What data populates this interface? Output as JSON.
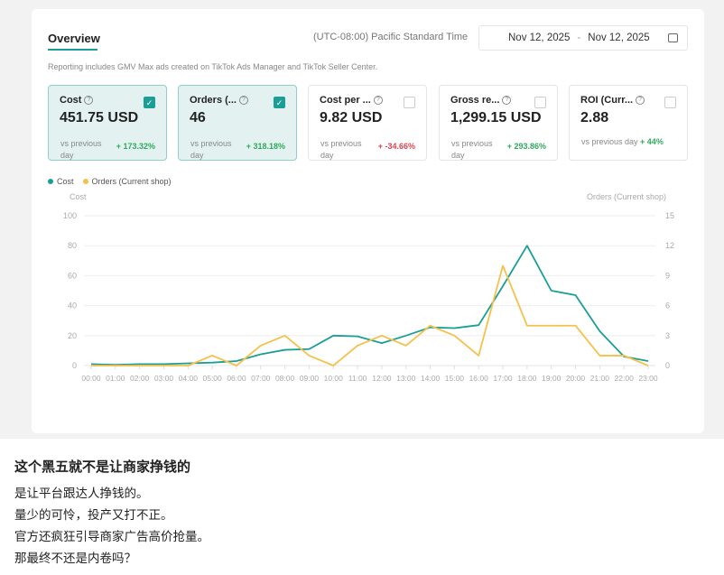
{
  "header": {
    "title": "Overview",
    "timezone": "(UTC-08:00) Pacific Standard Time",
    "date_start": "Nov 12, 2025",
    "date_sep": "-",
    "date_end": "Nov 12, 2025",
    "note": "Reporting includes GMV Max ads created on TikTok Ads Manager and TikTok Seller Center."
  },
  "kpis": [
    {
      "label": "Cost",
      "value": "451.75 USD",
      "vs": "vs previous day",
      "change": "+ 173.32%",
      "trend": "up",
      "checked": true
    },
    {
      "label": "Orders (...",
      "value": "46",
      "vs": "vs previous day",
      "change": "+ 318.18%",
      "trend": "up",
      "checked": true
    },
    {
      "label": "Cost per ...",
      "value": "9.82 USD",
      "vs": "vs previous day",
      "change": "+ -34.66%",
      "trend": "down",
      "checked": false
    },
    {
      "label": "Gross re...",
      "value": "1,299.15 USD",
      "vs": "vs previous day",
      "change": "+ 293.86%",
      "trend": "up",
      "checked": false
    },
    {
      "label": "ROI (Curr...",
      "value": "2.88",
      "vs": "vs previous day",
      "change": "+ 44%",
      "trend": "up",
      "checked": false
    }
  ],
  "colors": {
    "teal": "#1a9e95",
    "yellow": "#f5c14b",
    "up": "#2eaa5c",
    "down": "#d9434f"
  },
  "chart_data": {
    "type": "line",
    "legend": [
      "Cost",
      "Orders (Current shop)"
    ],
    "ylabel_left": "Cost",
    "ylabel_right": "Orders (Current shop)",
    "ylim_left": [
      0,
      100
    ],
    "yticks_left": [
      "0",
      "20",
      "40",
      "60",
      "80",
      "100"
    ],
    "ylim_right": [
      0,
      15
    ],
    "yticks_right": [
      "0",
      "3",
      "6",
      "9",
      "12",
      "15"
    ],
    "categories": [
      "00:00",
      "01:00",
      "02:00",
      "03:00",
      "04:00",
      "05:00",
      "06:00",
      "07:00",
      "08:00",
      "09:00",
      "10:00",
      "11:00",
      "12:00",
      "13:00",
      "14:00",
      "15:00",
      "16:00",
      "17:00",
      "18:00",
      "19:00",
      "20:00",
      "21:00",
      "22:00",
      "23:00"
    ],
    "series": [
      {
        "name": "Cost",
        "axis": "left",
        "values": [
          1,
          0.5,
          1,
          1,
          1.5,
          2,
          3,
          7.5,
          10.5,
          11,
          20,
          19.5,
          15,
          20,
          25.5,
          25,
          27,
          53,
          80,
          50,
          47,
          23,
          6,
          3
        ]
      },
      {
        "name": "Orders (Current shop)",
        "axis": "right",
        "values": [
          0,
          0,
          0,
          0,
          0,
          1,
          0,
          2,
          3,
          1,
          0,
          2,
          3,
          2,
          4,
          3,
          1,
          10,
          4,
          4,
          4,
          1,
          1,
          0
        ]
      }
    ]
  },
  "post": {
    "title": "这个黑五就不是让商家挣钱的",
    "lines": [
      "是让平台跟达人挣钱的。",
      "量少的可怜，投产又打不正。",
      "官方还疯狂引导商家广告高价抢量。",
      "那最终不还是内卷吗？"
    ]
  }
}
